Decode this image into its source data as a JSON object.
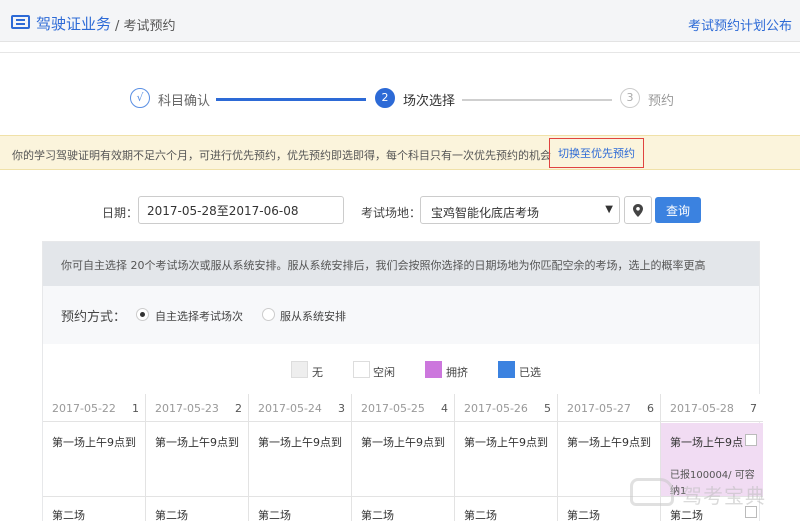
{
  "header": {
    "title": "驾驶证业务",
    "breadcrumb": "/ 考试预约",
    "plan_link": "考试预约计划公布"
  },
  "steps": [
    {
      "num": "√",
      "label": "科目确认"
    },
    {
      "num": "2",
      "label": "场次选择"
    },
    {
      "num": "3",
      "label": "预约"
    }
  ],
  "notice": {
    "text": "你的学习驾驶证明有效期不足六个月，可进行优先预约，优先预约即选即得，每个科目只有一次优先预约的机会",
    "switch_label": "切换至优先预约"
  },
  "filter": {
    "date_label": "日期：",
    "date_value": "2017-05-28至2017-06-08",
    "site_label": "考试场地：",
    "site_value": "宝鸡智能化底店考场",
    "query_label": "查询"
  },
  "panel": {
    "desc": "你可自主选择 20个考试场次或服从系统安排。服从系统安排后，我们会按照你选择的日期场地为你匹配空余的考场，选上的概率更高",
    "mode_label": "预约方式：",
    "mode_options": [
      "自主选择考试场次",
      "服从系统安排"
    ],
    "mode_selected": "自主选择考试场次"
  },
  "legend": [
    {
      "label": "无",
      "color": "#eeeeee"
    },
    {
      "label": "空闲",
      "color": "#ffffff"
    },
    {
      "label": "拥挤",
      "color": "#cc77dd"
    },
    {
      "label": "已选",
      "color": "#3b82e0"
    }
  ],
  "days": [
    {
      "date": "2017-05-22",
      "num": "1",
      "slot1": "第一场上午9点到",
      "slot2": "第二场"
    },
    {
      "date": "2017-05-23",
      "num": "2",
      "slot1": "第一场上午9点到",
      "slot2": "第二场"
    },
    {
      "date": "2017-05-24",
      "num": "3",
      "slot1": "第一场上午9点到",
      "slot2": "第二场"
    },
    {
      "date": "2017-05-25",
      "num": "4",
      "slot1": "第一场上午9点到",
      "slot2": "第二场"
    },
    {
      "date": "2017-05-26",
      "num": "5",
      "slot1": "第一场上午9点到",
      "slot2": "第二场"
    },
    {
      "date": "2017-05-27",
      "num": "6",
      "slot1": "第一场上午9点到",
      "slot2": "第二场"
    },
    {
      "date": "2017-05-28",
      "num": "7",
      "slot1": "第一场上午9点",
      "slot2": "第二场",
      "report": "已报100004/ 可容",
      "report2": "纳1"
    }
  ],
  "watermark": "驾考宝典"
}
